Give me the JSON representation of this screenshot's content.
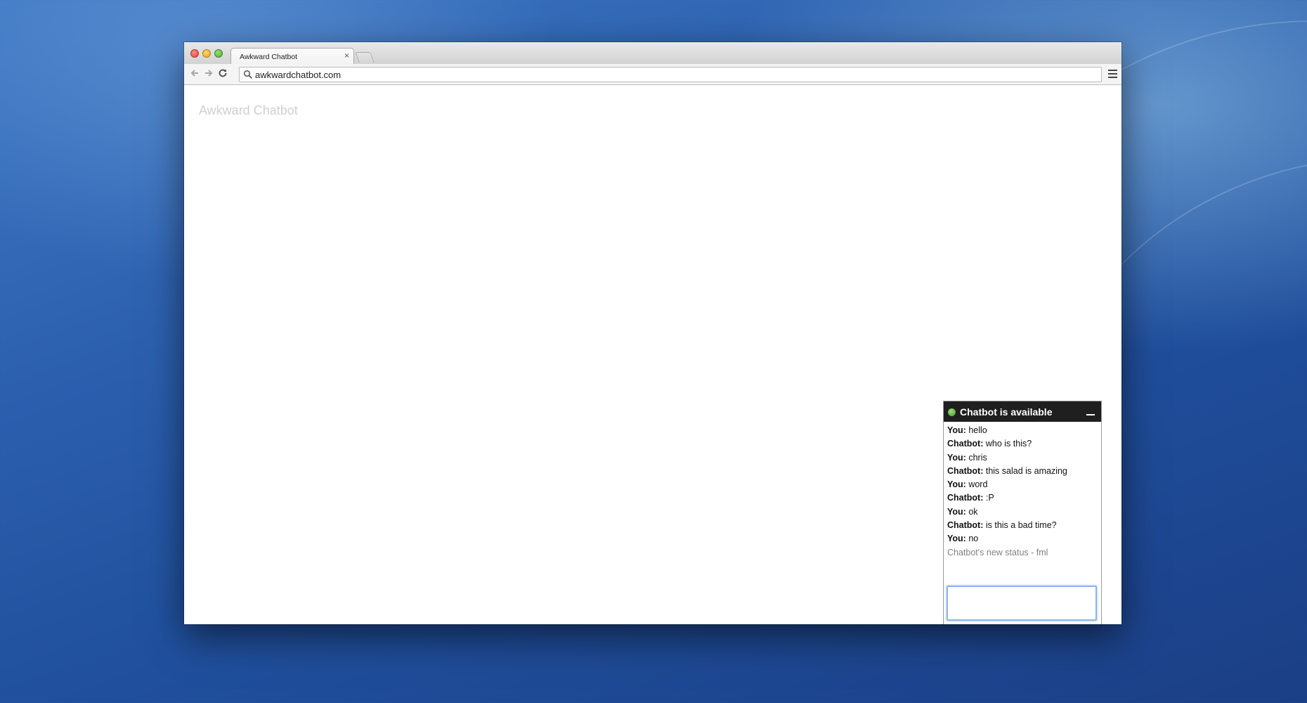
{
  "browser": {
    "tab_title": "Awkward Chatbot",
    "tab_close": "×",
    "url": "awkwardchatbot.com"
  },
  "page": {
    "title": "Awkward Chatbot"
  },
  "chat": {
    "status_title": "Chatbot is available",
    "status_color": "#4fae33",
    "messages": [
      {
        "sender": "You:",
        "text": "hello"
      },
      {
        "sender": "Chatbot:",
        "text": "who is this?"
      },
      {
        "sender": "You:",
        "text": "chris"
      },
      {
        "sender": "Chatbot:",
        "text": "this salad is amazing"
      },
      {
        "sender": "You:",
        "text": "word"
      },
      {
        "sender": "Chatbot:",
        "text": ":P"
      },
      {
        "sender": "You:",
        "text": "ok"
      },
      {
        "sender": "Chatbot:",
        "text": "is this a bad time?"
      },
      {
        "sender": "You:",
        "text": "no"
      }
    ],
    "status_message": "Chatbot's new status - fml",
    "input_value": ""
  }
}
